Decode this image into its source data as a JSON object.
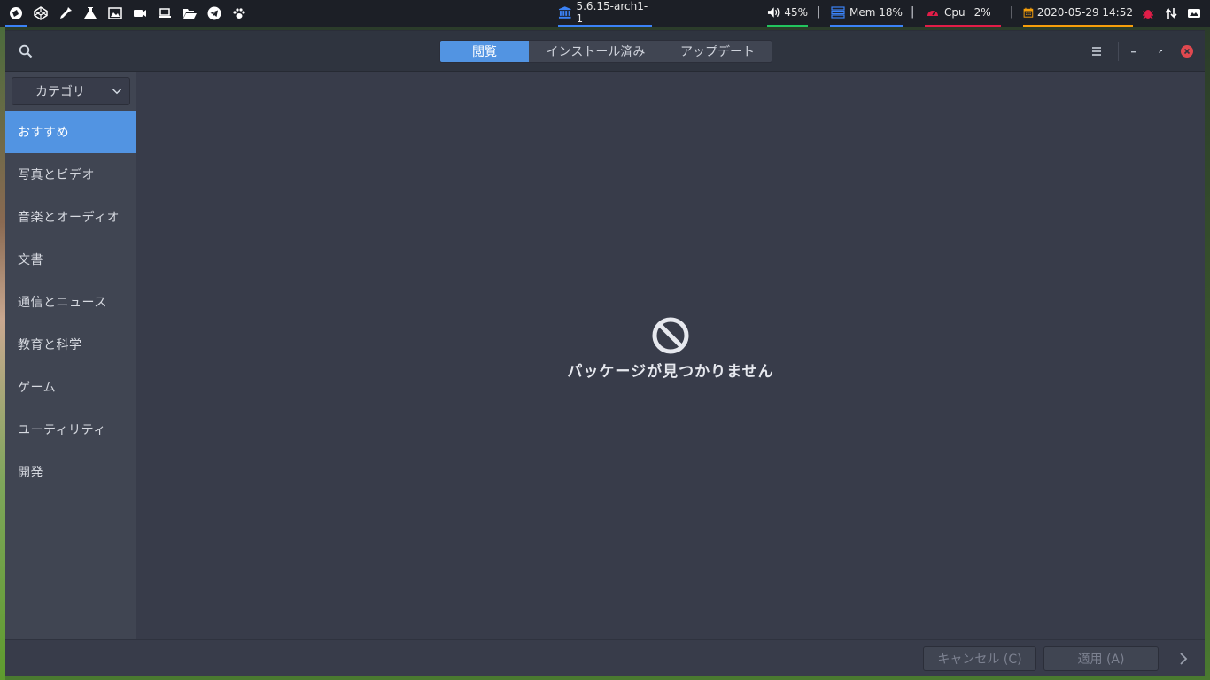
{
  "top_panel": {
    "launchers": [
      {
        "icon": "browser-icon",
        "active": true
      },
      {
        "icon": "codepen-icon",
        "active": false
      },
      {
        "icon": "eyedropper-icon",
        "active": false
      },
      {
        "icon": "flask-icon",
        "active": false
      },
      {
        "icon": "image-icon",
        "active": false
      },
      {
        "icon": "video-camera-icon",
        "active": false
      },
      {
        "icon": "laptop-icon",
        "active": false
      },
      {
        "icon": "folder-open-icon",
        "active": false
      },
      {
        "icon": "telegram-icon",
        "active": false
      },
      {
        "icon": "paw-icon",
        "active": false
      }
    ],
    "kernel": "5.6.15-arch1-1",
    "volume": "45%",
    "mem": "Mem 18%",
    "cpu_label": "Cpu",
    "cpu_value": "2%",
    "clock": "2020-05-29 14:52",
    "separator": "|",
    "colors": {
      "accent_blue": "#3b82f6",
      "volume_green": "#22c55e",
      "cpu_red": "#e11d48",
      "clock_orange": "#f59e0b"
    }
  },
  "headerbar": {
    "tabs": [
      {
        "label": "閲覧",
        "active": true
      },
      {
        "label": "インストール済み",
        "active": false
      },
      {
        "label": "アップデート",
        "active": false
      }
    ]
  },
  "sidebar": {
    "category_select": "カテゴリ",
    "items": [
      {
        "label": "おすすめ",
        "active": true
      },
      {
        "label": "写真とビデオ",
        "active": false
      },
      {
        "label": "音楽とオーディオ",
        "active": false
      },
      {
        "label": "文書",
        "active": false
      },
      {
        "label": "通信とニュース",
        "active": false
      },
      {
        "label": "教育と科学",
        "active": false
      },
      {
        "label": "ゲーム",
        "active": false
      },
      {
        "label": "ユーティリティ",
        "active": false
      },
      {
        "label": "開発",
        "active": false
      }
    ]
  },
  "main": {
    "empty_message": "パッケージが見つかりません"
  },
  "actionbar": {
    "cancel_label": "キャンセル (C)",
    "apply_label": "適用 (A)"
  },
  "theme": {
    "selection": "#5294e2",
    "window_bg": "#383c4a",
    "sidebar_bg": "#404552",
    "close_red": "#e0484f"
  }
}
